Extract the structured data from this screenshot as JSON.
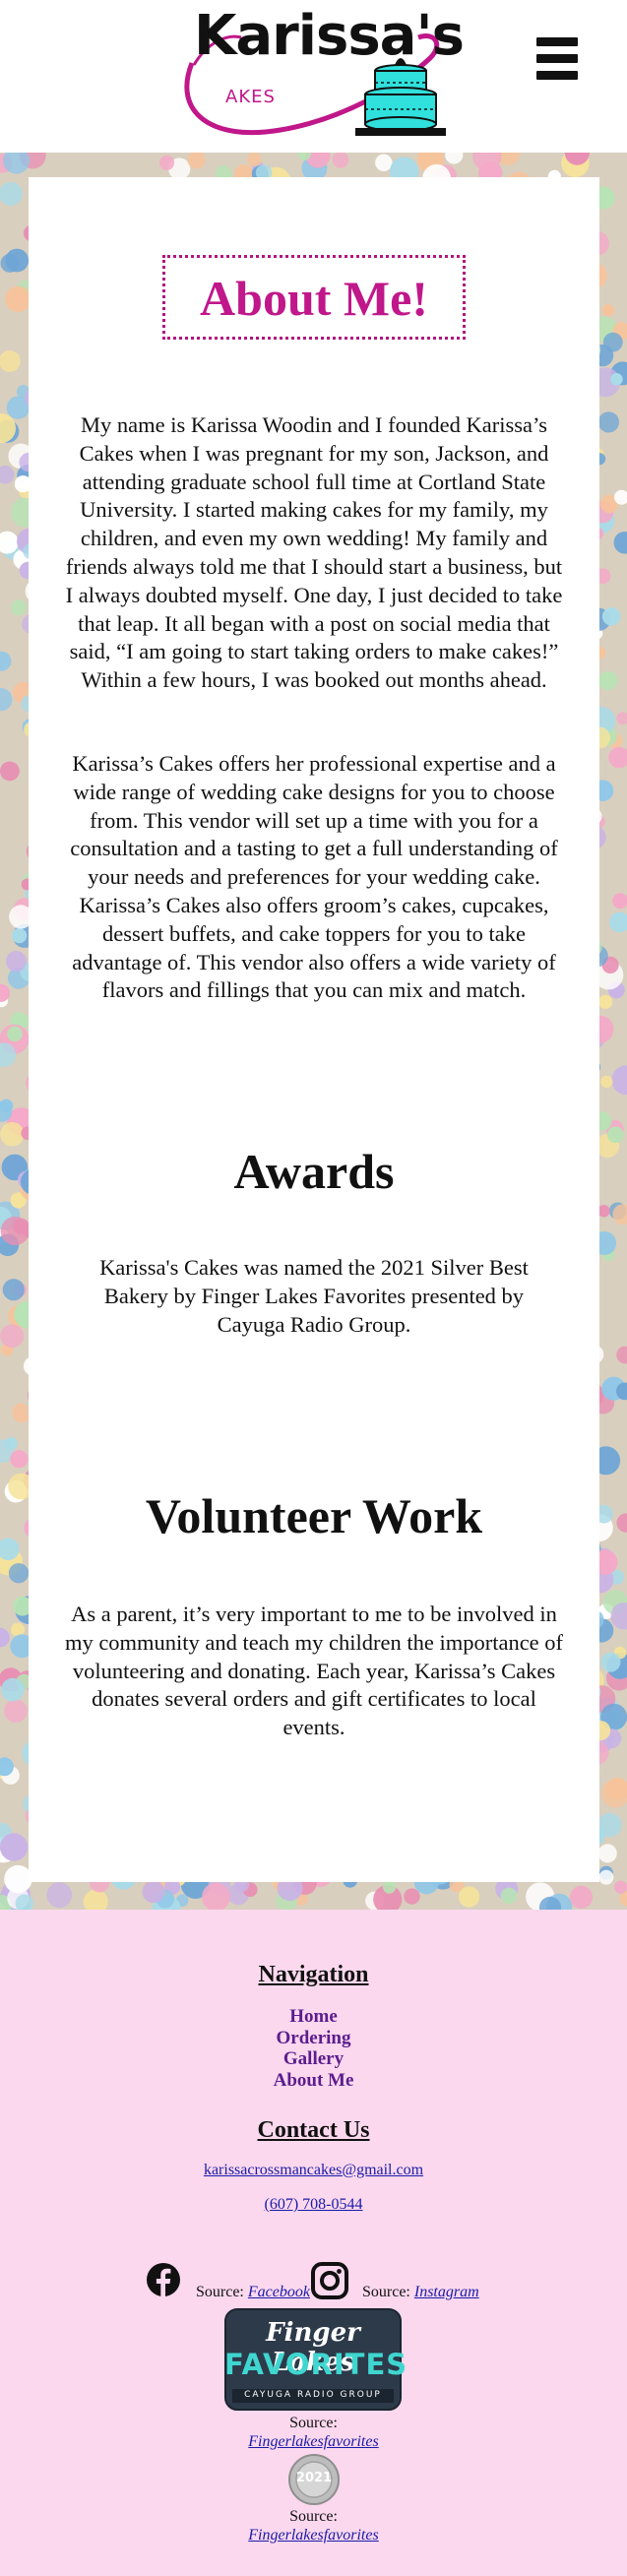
{
  "header": {
    "logo_text_main": "Karissa's",
    "logo_text_sub": "AKES",
    "menu_icon": "hamburger-menu-icon"
  },
  "about": {
    "title": "About Me!",
    "paragraph1": "My name is Karissa Woodin and I founded Karissa’s Cakes when I was pregnant for my son, Jackson, and attending graduate school full time at Cortland State University. I started making cakes for my family, my children, and even my own wedding! My family and friends always told me that I should start a business, but I always doubted myself. One day, I just decided to take that leap. It all began with a post on social media that said, “I am going to start taking orders to make cakes!” Within a few hours, I was booked out months ahead.",
    "paragraph2": "Karissa’s Cakes offers her professional expertise and a wide range of wedding cake designs for you to choose from. This vendor will set up a time with you for a consultation and a tasting to get a full understanding of your needs and preferences for your wedding cake. Karissa’s Cakes also offers groom’s cakes, cupcakes, dessert buffets, and cake toppers for you to take advantage of. This vendor also offers a wide variety of flavors and fillings that you can mix and match."
  },
  "awards": {
    "title": "Awards",
    "paragraph": "Karissa's Cakes was named the 2021 Silver Best Bakery by Finger Lakes Favorites presented by Cayuga Radio Group."
  },
  "volunteer": {
    "title": "Volunteer Work",
    "paragraph": "As a parent, it’s very important to me to be involved in my community and teach my children the importance of volunteering and donating. Each year, Karissa’s Cakes donates several orders and gift certificates to local events."
  },
  "footer": {
    "nav_title": "Navigation",
    "nav_items": [
      "Home",
      "Ordering",
      "Gallery",
      "About Me"
    ],
    "contact_title": "Contact Us",
    "email": "karissacrossmancakes@gmail.com",
    "phone": "(607) 708-0544",
    "facebook_source_label": "Source:",
    "facebook_link": "Facebook",
    "instagram_source_label": "Source:",
    "instagram_link": "Instagram",
    "badge_line1": "Finger Lakes",
    "badge_line2": "FAVORITES",
    "badge_line3": "CAYUGA RADIO GROUP",
    "badge_source_label": "Source:",
    "badge_source_link": "Fingerlakesfavorites",
    "medal_year": "2021",
    "medal_source_label": "Source:",
    "medal_source_link": "Fingerlakesfavorites"
  },
  "colors": {
    "accent_magenta": "#c0178a",
    "teal": "#2fe0dc",
    "footer_bg": "#fbd8ee",
    "nav_link": "#5b1d8e",
    "link_blue": "#1b1ba8"
  }
}
